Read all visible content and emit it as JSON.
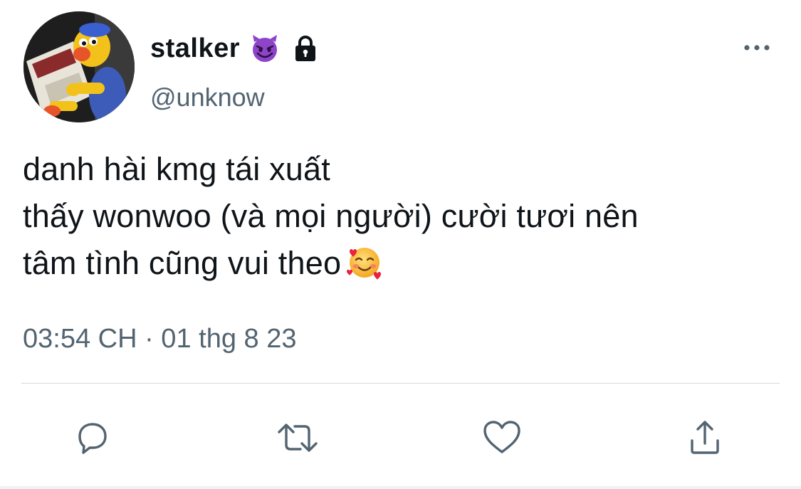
{
  "user": {
    "display_name": "stalker",
    "handle": "@unknow",
    "name_emoji": "smiling-imp-emoji",
    "protected_icon": "lock-icon",
    "avatar": "puppet-reading-book-avatar"
  },
  "tweet": {
    "lines": [
      "danh hài kmg tái xuất",
      "thấy wonwoo (và mọi người) cười tươi nên",
      "tâm tình cũng vui theo"
    ],
    "trailing_emoji": "smiling-face-with-hearts-emoji",
    "timestamp": "03:54 CH · 01 thg 8 23"
  },
  "actions": {
    "more": "more-icon",
    "reply": "reply-icon",
    "retweet": "retweet-icon",
    "like": "heart-icon",
    "share": "share-icon"
  },
  "colors": {
    "text_primary": "#0f1419",
    "text_secondary": "#536471",
    "divider": "#cfd9de",
    "icon": "#536471",
    "devil_purple": "#8e44c9"
  }
}
